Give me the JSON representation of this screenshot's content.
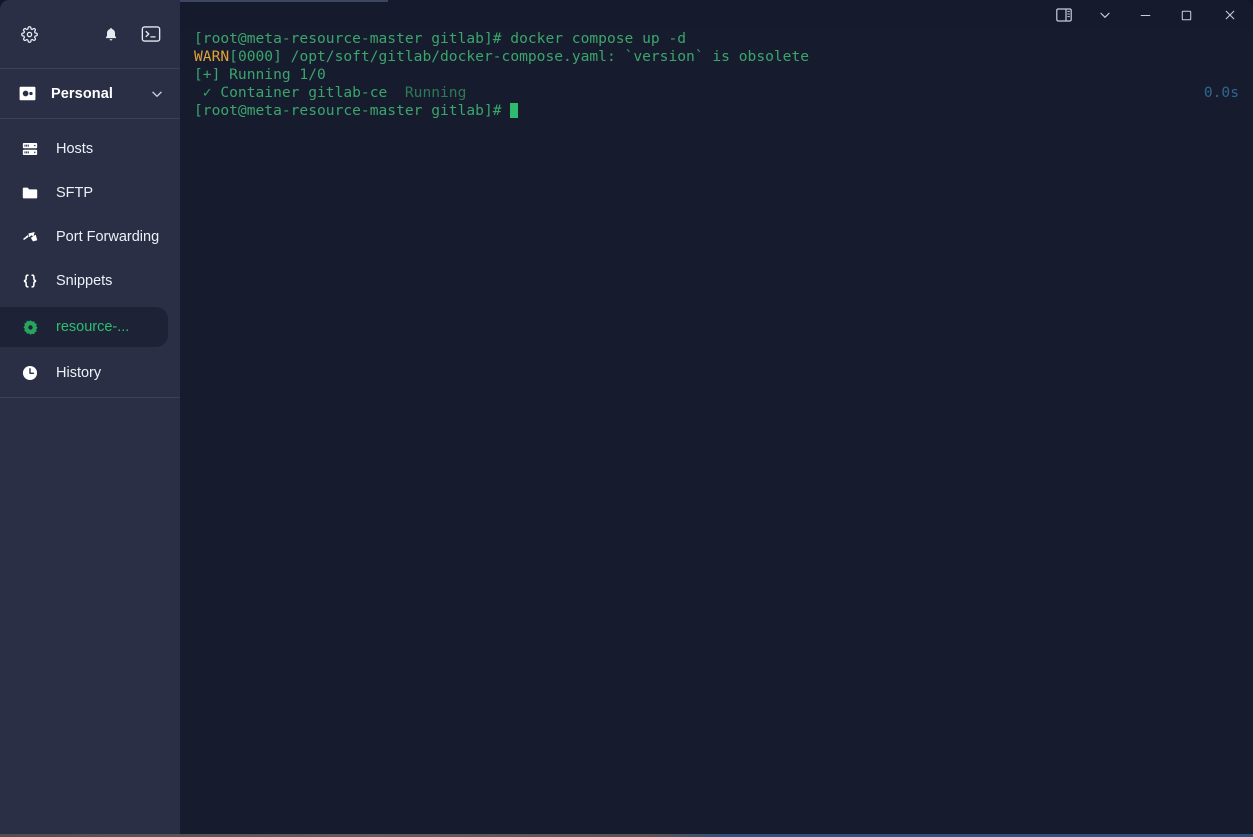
{
  "window": {
    "titlebar": {
      "buttons": [
        {
          "name": "panel-toggle",
          "icon": "panel-layout-icon",
          "label": ""
        },
        {
          "name": "chevron-down",
          "icon": "chevron-down-icon",
          "label": ""
        },
        {
          "name": "minimize",
          "icon": "minimize-icon",
          "label": ""
        },
        {
          "name": "maximize",
          "icon": "maximize-icon",
          "label": ""
        },
        {
          "name": "close",
          "icon": "close-icon",
          "label": ""
        }
      ]
    }
  },
  "sidebar": {
    "toolbar": {
      "settings_icon": "gear-icon",
      "notifications_icon": "bell-icon",
      "terminal_icon": "terminal-icon"
    },
    "vault": {
      "icon": "vault-icon",
      "label": "Personal",
      "expander_icon": "chevron-down-icon"
    },
    "items": [
      {
        "label": "Hosts",
        "icon": "server-rack-icon",
        "active": false
      },
      {
        "label": "SFTP",
        "icon": "folder-icon",
        "active": false
      },
      {
        "label": "Port Forwarding",
        "icon": "arrow-forward-icon",
        "active": false
      },
      {
        "label": "Snippets",
        "icon": "curly-braces-icon",
        "active": false
      },
      {
        "label": "resource-...",
        "icon": "gear-sparkle-icon",
        "active": true
      },
      {
        "label": "History",
        "icon": "clock-icon",
        "active": false
      }
    ]
  },
  "terminal": {
    "lines": [
      {
        "segments": [
          {
            "text": "[root@meta-resource-master gitlab]# docker compose up -d",
            "color": "green"
          }
        ]
      },
      {
        "segments": [
          {
            "text": "WARN",
            "color": "warn"
          },
          {
            "text": "[0000] /opt/soft/gitlab/docker-compose.yaml: `version` is obsolete",
            "color": "green"
          }
        ]
      },
      {
        "segments": [
          {
            "text": "[+] Running 1/0",
            "color": "green"
          }
        ]
      },
      {
        "segments": [
          {
            "text": " ✓ Container gitlab-ce  ",
            "color": "green"
          },
          {
            "text": "Running",
            "color": "green-dim"
          }
        ],
        "right": "0.0s"
      },
      {
        "segments": [
          {
            "text": "[root@meta-resource-master gitlab]# ",
            "color": "green"
          }
        ],
        "cursor": true
      }
    ]
  },
  "colors": {
    "sidebar_bg": "#2a2f45",
    "terminal_bg": "#161b2e",
    "accent_green": "#3aa66b",
    "active_green": "#2bbf6e",
    "warn_orange": "#e0a33a",
    "timer_blue": "#2f6792"
  }
}
